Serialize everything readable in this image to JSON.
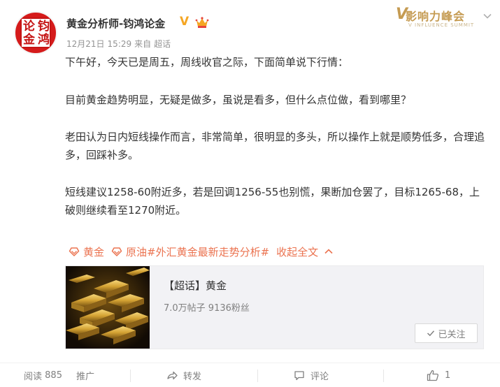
{
  "header": {
    "username": "黄金分析师-钧鸿论金",
    "verified_mark": "V",
    "date": "12月21日",
    "time": "15:29",
    "source_prefix": "来自",
    "source": "超话",
    "avatar_chars": [
      "钧",
      "鸿",
      "论",
      "金"
    ],
    "summit_logo": {
      "title": "影响力峰会",
      "subtitle": "V INFLUENCE SUMMIT"
    }
  },
  "post": {
    "paragraphs": [
      "下午好，今天已是周五，周线收官之际，下面简单说下行情：",
      "目前黄金趋势明显，无疑是做多，虽说是看多，但什么点位做，看到哪里？",
      "老田认为日内短线操作而言，非常简单，很明显的多头，所以操作上就是顺势低多，合理追多，回踩补多。",
      "短线建议1258-60附近多，若是回调1256-55也别慌，果断加仓罢了，目标1265-68，上破则继续看至1270附近。"
    ]
  },
  "tags": {
    "tag1": "黄金",
    "tag2": "原油",
    "hashtag": "#外汇黄金最新走势分析#",
    "collapse_label": "收起全文"
  },
  "topic_card": {
    "title": "【超话】黄金",
    "stats": "7.0万帖子 9136粉丝",
    "follow_label": "已关注"
  },
  "footer": {
    "read_label": "阅读",
    "read_count": "885",
    "promote_label": "推广",
    "forward_label": "转发",
    "comment_label": "评论",
    "like_count": "1"
  },
  "colors": {
    "accent": "#eb7350",
    "verified": "#f5a623",
    "avatar_red": "#d51b1b",
    "text": "#333333",
    "muted": "#939393"
  }
}
